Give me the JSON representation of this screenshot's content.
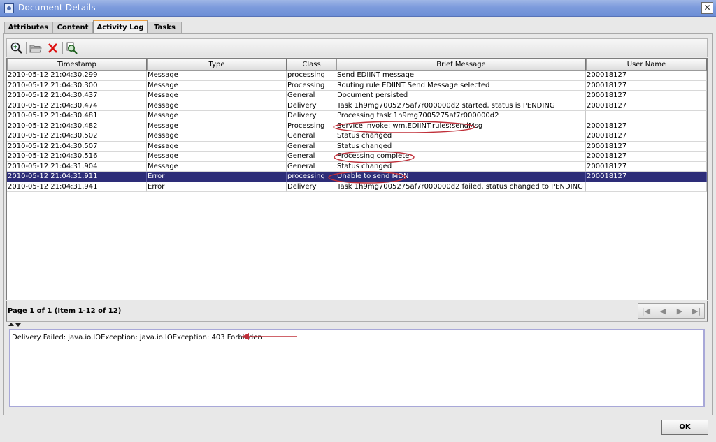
{
  "window": {
    "title": "Document Details",
    "close_glyph": "✕"
  },
  "tabs": [
    {
      "label": "Attributes",
      "active": false
    },
    {
      "label": "Content",
      "active": false
    },
    {
      "label": "Activity Log",
      "active": true
    },
    {
      "label": "Tasks",
      "active": false
    }
  ],
  "toolbar": {
    "buttons": [
      {
        "icon": "zoom-in-icon"
      },
      {
        "icon": "open-folder-icon"
      },
      {
        "icon": "delete-icon"
      },
      {
        "icon": "find-icon"
      }
    ]
  },
  "table": {
    "columns": [
      "Timestamp",
      "Type",
      "Class",
      "Brief Message",
      "User Name"
    ],
    "rows": [
      [
        "2010-05-12 21:04:30.299",
        "Message",
        "processing",
        "Send EDIINT message",
        "200018127"
      ],
      [
        "2010-05-12 21:04:30.300",
        "Message",
        "Processing",
        "Routing rule EDIINT Send Message selected",
        "200018127"
      ],
      [
        "2010-05-12 21:04:30.437",
        "Message",
        "General",
        "Document persisted",
        "200018127"
      ],
      [
        "2010-05-12 21:04:30.474",
        "Message",
        "Delivery",
        "Task 1h9mg7005275af7r000000d2 started, status is PENDING",
        "200018127"
      ],
      [
        "2010-05-12 21:04:30.481",
        "Message",
        "Delivery",
        "Processing task 1h9mg7005275af7r000000d2",
        ""
      ],
      [
        "2010-05-12 21:04:30.482",
        "Message",
        "Processing",
        "Service invoke: wm.EDIINT.rules:sendMsg",
        "200018127"
      ],
      [
        "2010-05-12 21:04:30.502",
        "Message",
        "General",
        "Status changed",
        "200018127"
      ],
      [
        "2010-05-12 21:04:30.507",
        "Message",
        "General",
        "Status changed",
        "200018127"
      ],
      [
        "2010-05-12 21:04:30.516",
        "Message",
        "General",
        "Processing complete",
        "200018127"
      ],
      [
        "2010-05-12 21:04:31.904",
        "Message",
        "General",
        "Status changed",
        "200018127"
      ],
      [
        "2010-05-12 21:04:31.911",
        "Error",
        "processing",
        "Unable to send MDN",
        "200018127"
      ],
      [
        "2010-05-12 21:04:31.941",
        "Error",
        "Delivery",
        "Task 1h9mg7005275af7r000000d2 failed, status changed to PENDING",
        ""
      ]
    ],
    "selected_row": 10,
    "circled_rows": [
      5,
      8,
      10
    ]
  },
  "pager": {
    "text": "Page 1 of 1 (Item 1-12 of 12)",
    "buttons": [
      {
        "icon": "first-page-icon",
        "glyph": "|◀"
      },
      {
        "icon": "prev-page-icon",
        "glyph": "◀"
      },
      {
        "icon": "next-page-icon",
        "glyph": "▶"
      },
      {
        "icon": "last-page-icon",
        "glyph": "▶|"
      }
    ]
  },
  "detail": {
    "text": "Delivery Failed: java.io.IOException: java.io.IOException: 403 Forbidden"
  },
  "ok_button": {
    "label": "OK"
  },
  "colors": {
    "selection": "#2d2d78",
    "annotation": "#c0303a",
    "titlebar": "#7d9bdc"
  }
}
